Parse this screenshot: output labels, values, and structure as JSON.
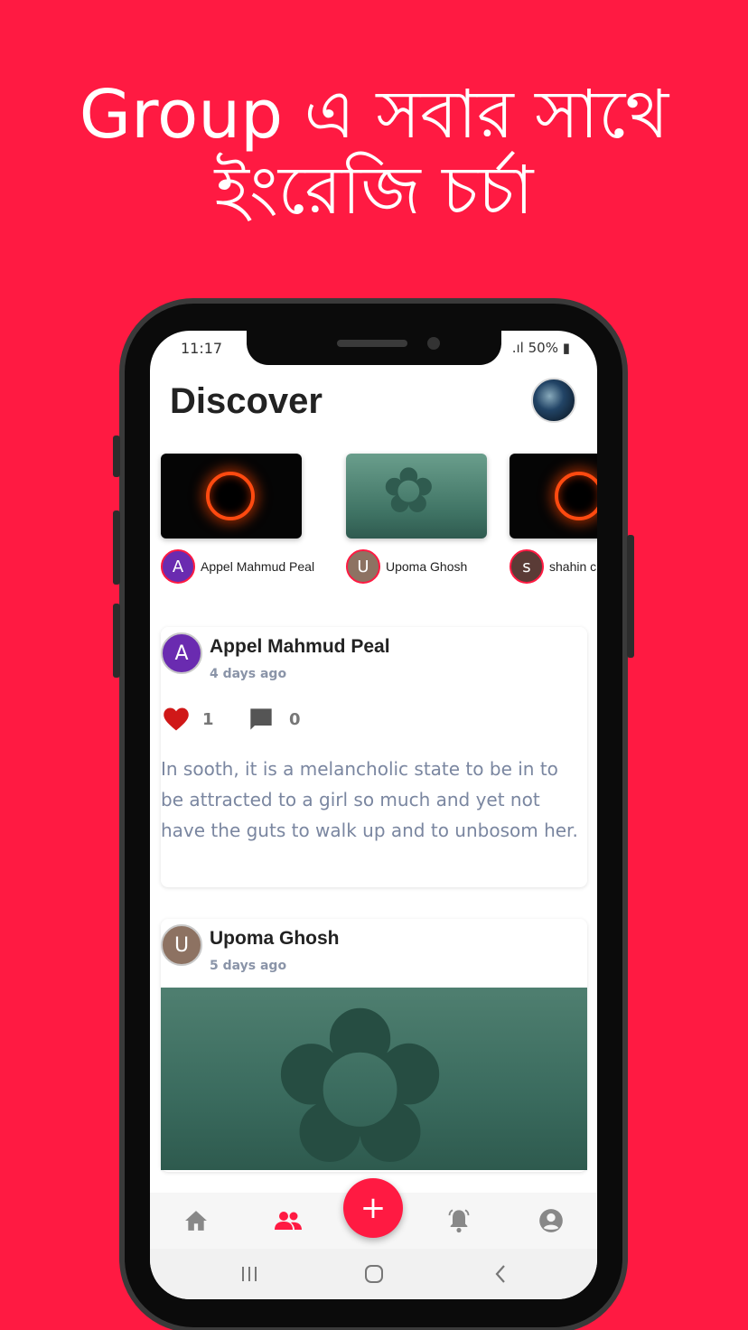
{
  "headline": {
    "line1": "Group এ সবার সাথে",
    "line2": "ইংরেজি চর্চা"
  },
  "status_bar": {
    "time": "11:17",
    "battery": "50%"
  },
  "page_title": "Discover",
  "stories": [
    {
      "author": "Appel Mahmud Peal",
      "initial": "A",
      "avatar_color": "#6a2bb0",
      "thumb": "blackhole"
    },
    {
      "author": "Upoma Ghosh",
      "initial": "U",
      "avatar_color": "#8d7262",
      "thumb": "sponge"
    },
    {
      "author": "shahin c",
      "initial": "s",
      "avatar_color": "#5a3b36",
      "thumb": "blackhole"
    }
  ],
  "posts": [
    {
      "author": "Appel Mahmud Peal",
      "initial": "A",
      "avatar_color": "#6a2bb0",
      "time": "4 days ago",
      "likes": "1",
      "comments": "0",
      "text": "In sooth, it is a melancholic state to be in to be attracted to a girl so much and yet not have the guts to walk up and to unbosom her."
    },
    {
      "author": "Upoma Ghosh",
      "initial": "U",
      "avatar_color": "#8d7262",
      "time": "5 days ago"
    }
  ],
  "bottom_nav": {
    "items": [
      "home-icon",
      "group-icon",
      "notification-icon",
      "account-icon"
    ],
    "fab_label": "+"
  },
  "colors": {
    "accent": "#ff1a42",
    "heart": "#d01818"
  }
}
